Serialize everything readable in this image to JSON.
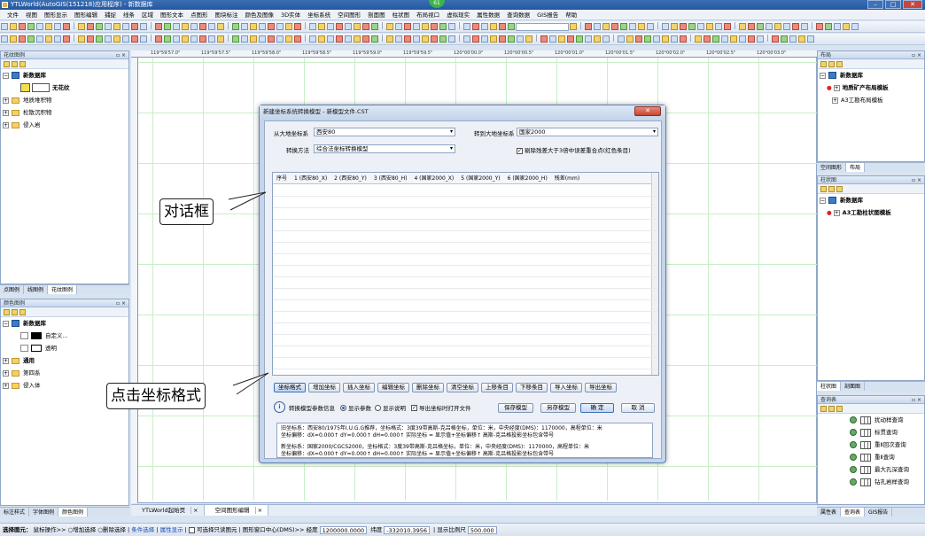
{
  "window": {
    "title": "YTLWorld(AutoGIS(151218)应用程序) - 新数据库",
    "badge": "61"
  },
  "menu": [
    "文件",
    "视图",
    "图形显示",
    "图形编辑",
    "捕捉",
    "线条",
    "区域",
    "图形文本",
    "点图形",
    "图块标注",
    "颜色及图像",
    "3D实体",
    "坐标系统",
    "空间图形",
    "剖面图",
    "柱状图",
    "布局视口",
    "虚拟现实",
    "属性数据",
    "查询数据",
    "GIS报告",
    "帮助"
  ],
  "ruler_labels": [
    "119°59'57.0\"",
    "119°59'57.5\"",
    "119°59'58.0\"",
    "119°59'58.5\"",
    "119°59'59.0\"",
    "119°59'59.5\"",
    "120°00'00.0\"",
    "120°00'00.5\"",
    "120°00'01.0\"",
    "120°00'01.5\"",
    "120°00'02.0\"",
    "120°00'02.5\"",
    "120°00'03.0\""
  ],
  "left_top": {
    "title": "花纹图例",
    "root": "新数据库",
    "items": [
      "无花纹",
      "地质堆积物",
      "松散沉积物",
      "侵入岩"
    ],
    "tabs": [
      "点图例",
      "线图例",
      "花纹图例"
    ]
  },
  "left_bottom": {
    "title": "颜色图例",
    "root": "新数据库",
    "items": [
      "自定义...",
      "透明",
      "通用",
      "第四系",
      "侵入体"
    ],
    "tabs": [
      "标注样式",
      "字体图例",
      "颜色图例"
    ]
  },
  "right_layout": {
    "title": "布局",
    "root": "新数据库",
    "items": [
      "地质矿产布局模板",
      "A3工勘布局模板"
    ],
    "tabs": [
      "空间图形",
      "布局"
    ]
  },
  "right_column": {
    "title": "柱状图",
    "root": "新数据库",
    "items": [
      "A3工勘柱状图模板"
    ],
    "tabs": [
      "柱状图",
      "剖面图"
    ]
  },
  "right_query": {
    "title": "查询表",
    "items": [
      "扰动样查询",
      "标贯查询",
      "重Ⅱ回次查询",
      "重Ⅱ查询",
      "最大孔深查询",
      "钻孔岩样查询"
    ],
    "tabs": [
      "属性表",
      "查询表",
      "GIS报告"
    ]
  },
  "doc_tabs": [
    "YTLWorld起始页",
    "空间图形编辑"
  ],
  "dialog": {
    "title": "新建坐标系统转换模型 - 新模型文件.CST",
    "from_label": "从大地坐标系",
    "from_value": "西安80",
    "to_label": "转到大地坐标系",
    "to_value": "国家2000",
    "method_label": "转换方法",
    "method_value": "综合法坐标转换模型",
    "exclude_label": "剔除残差大于3倍中误差重合点(红色条目)",
    "exclude_checked": true,
    "columns": [
      "序号",
      "1 (西安80_X)",
      "2 (西安80_Y)",
      "3 (西安80_H)",
      "4 (国家2000_X)",
      "5 (国家2000_Y)",
      "6 (国家2000_H)",
      "残差(mm)"
    ],
    "buttons": [
      "坐标格式",
      "增加坐标",
      "插入坐标",
      "编辑坐标",
      "删除坐标",
      "清空坐标",
      "上移条目",
      "下移条目",
      "导入坐标",
      "导出坐标"
    ],
    "info_label": "转换模型参数信息",
    "radio1": "显示参数",
    "radio2": "显示说明",
    "export_chk": "导出坐标时打开文件",
    "save_model": "保存模型",
    "save_as": "另存模型",
    "ok": "确 定",
    "cancel": "取 消",
    "info_lines": [
      "旧坐标系：西安80/1975年I.U.G.G推荐，坐标格式：3度39带高斯-克吕格坐标，单位：米，中央经度(DMS)：1170000，高程单位：米",
      "坐标偏移：dX=0.000↑ dY=0.000↑ dH=0.000↑ 实际坐标 = 显示值+坐标偏移↑ 高斯-克吕格投影坐标包含带号",
      "新坐标系：国家2000/CGCS2000，坐标格式：3度39带高斯-克吕格坐标，单位：米，中央经度(DMS)：1170000，高程单位：米",
      "坐标偏移：dX=0.000↑ dY=0.000↑ dH=0.000↑ 实际坐标 = 显示值+坐标偏移↑ 高斯-克吕格投影坐标包含带号"
    ]
  },
  "callouts": {
    "dialog": "对话框",
    "click": "点击坐标格式"
  },
  "status": {
    "label": "选择图元：",
    "mode": "鼠标操作>> ○增加选择 ○删除选择",
    "cond": "条件选择",
    "attr": "属性显示",
    "check": "可选择只读图元",
    "view": "图形窗口中心(DMS)>>",
    "lon_label": "经度",
    "lon": "1200000.0000",
    "lat_label": "纬度",
    "lat": "-332010.3956",
    "scale_label": "显示比例尺",
    "scale": "500.000"
  }
}
